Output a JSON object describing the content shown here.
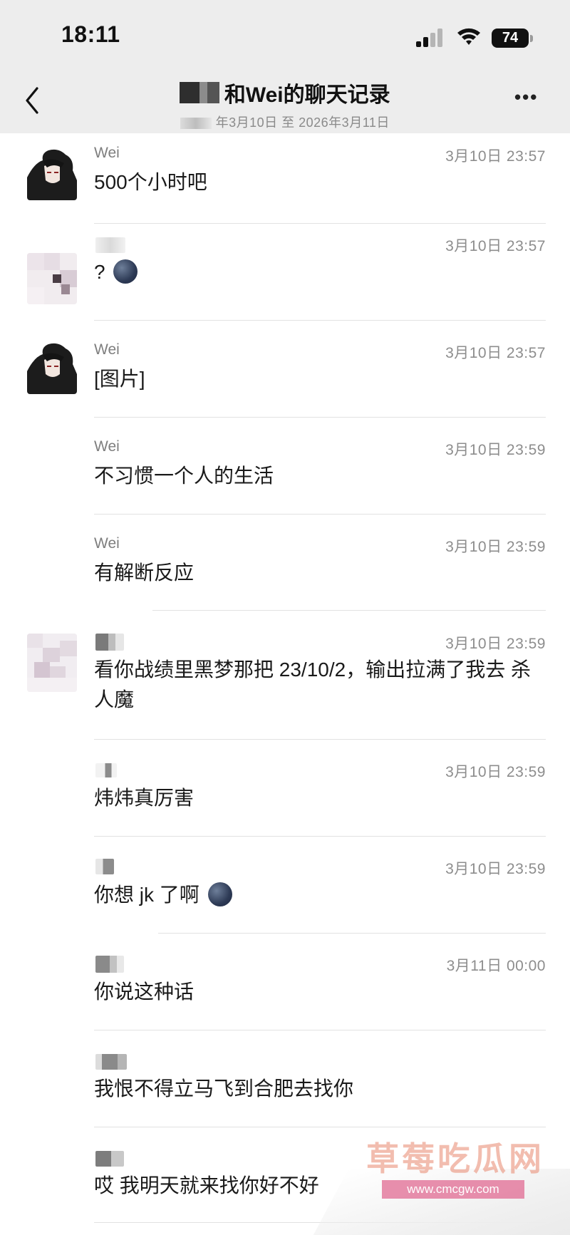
{
  "status_bar": {
    "time": "18:11",
    "battery": "74"
  },
  "header": {
    "title": "和Wei的聊天记录",
    "subtitle": "年3月10日 至 2026年3月11日"
  },
  "messages": [
    {
      "sender": "Wei",
      "time": "3月10日 23:57",
      "text": "500个小时吧",
      "avatar": "anime"
    },
    {
      "sender": "",
      "time": "3月10日 23:57",
      "text": "?",
      "avatar": "blurred",
      "emoji": "dark-face-emoji"
    },
    {
      "sender": "Wei",
      "time": "3月10日 23:57",
      "text": "[图片]",
      "avatar": "anime"
    },
    {
      "sender": "Wei",
      "time": "3月10日 23:59",
      "text": "不习惯一个人的生活",
      "avatar": "none"
    },
    {
      "sender": "Wei",
      "time": "3月10日 23:59",
      "text": "有解断反应",
      "avatar": "none"
    },
    {
      "sender": "",
      "time": "3月10日 23:59",
      "text": "看你战绩里黑梦那把 23/10/2，输出拉满了我去 杀人魔",
      "avatar": "blurred"
    },
    {
      "sender": "",
      "time": "3月10日 23:59",
      "text": "炜炜真厉害",
      "avatar": "none"
    },
    {
      "sender": "",
      "time": "3月10日 23:59",
      "text": "你想 jk 了啊",
      "avatar": "none",
      "emoji": "dark-face-emoji"
    },
    {
      "sender": "",
      "time": "3月11日 00:00",
      "text": "你说这种话",
      "avatar": "none"
    },
    {
      "sender": "",
      "time": "",
      "text": "我恨不得立马飞到合肥去找你",
      "avatar": "none"
    },
    {
      "sender": "",
      "time": "",
      "text": "哎 我明天就来找你好不好",
      "avatar": "none"
    }
  ],
  "watermark": {
    "title": "草莓吃瓜网",
    "url": "www.cmcgw.com"
  }
}
